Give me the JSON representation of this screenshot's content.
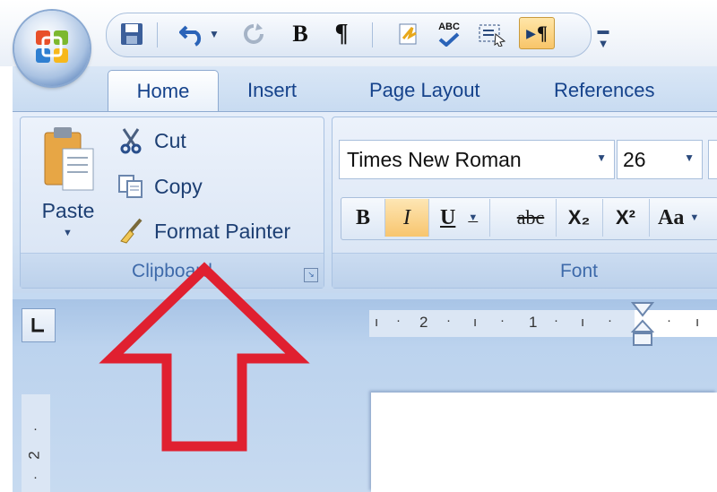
{
  "quick_access": {
    "icons": [
      "save-icon",
      "undo-icon",
      "redo-icon",
      "bold-icon",
      "pilcrow-icon",
      "spelling-icon",
      "spelling-grammar-icon",
      "select-icon",
      "show-formatting-icon",
      "customize-icon"
    ],
    "bold_glyph": "B",
    "pilcrow_glyph": "¶",
    "abc_glyph": "ABC"
  },
  "tabs": [
    "Home",
    "Insert",
    "Page Layout",
    "References"
  ],
  "clipboard": {
    "paste_label": "Paste",
    "cut_label": "Cut",
    "copy_label": "Copy",
    "format_painter_label": "Format Painter",
    "group_label": "Clipboard"
  },
  "font": {
    "family_value": "Times New Roman",
    "size_value": "26",
    "group_label": "Font",
    "buttons": [
      "B",
      "I",
      "U",
      "abc",
      "X₂",
      "X²",
      "Aa"
    ]
  },
  "ruler": {
    "marks": [
      "2",
      "1"
    ]
  },
  "vruler": {
    "mark": "2"
  },
  "colors": {
    "accent": "#15428b",
    "arrow": "#e02030",
    "ribbon": "#c4d9f1",
    "highlight": "#fbd18a"
  }
}
